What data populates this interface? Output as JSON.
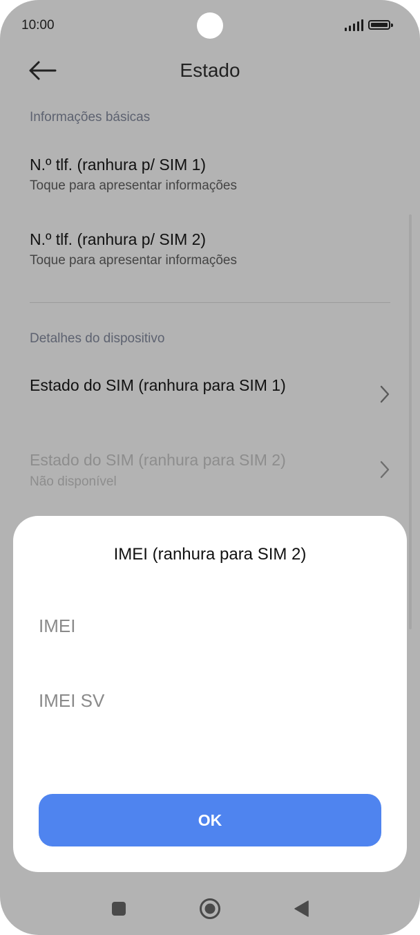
{
  "status_bar": {
    "time": "10:00"
  },
  "header": {
    "title": "Estado"
  },
  "sections": {
    "basic": "Informações básicas",
    "device": "Detalhes do dispositivo"
  },
  "items": [
    {
      "title": "N.º tlf. (ranhura p/ SIM 1)",
      "subtitle": "Toque para apresentar informações"
    },
    {
      "title": "N.º tlf. (ranhura p/ SIM 2)",
      "subtitle": "Toque para apresentar informações"
    },
    {
      "title": "Estado do SIM (ranhura para SIM 1)"
    },
    {
      "title": "Estado do SIM (ranhura para SIM 2)",
      "subtitle": "Não disponível"
    }
  ],
  "dialog": {
    "title": "IMEI (ranhura para SIM 2)",
    "fields": [
      "IMEI",
      "IMEI SV"
    ],
    "ok_label": "OK"
  },
  "icons": {
    "back": "arrow-left-icon",
    "chevron": "chevron-right-icon",
    "nav_recents": "square-icon",
    "nav_home": "circle-icon",
    "nav_back": "triangle-back-icon"
  },
  "colors": {
    "scrim": "#b3b3b3",
    "dialog_bg": "#ffffff",
    "accent": "#4f84ef"
  }
}
